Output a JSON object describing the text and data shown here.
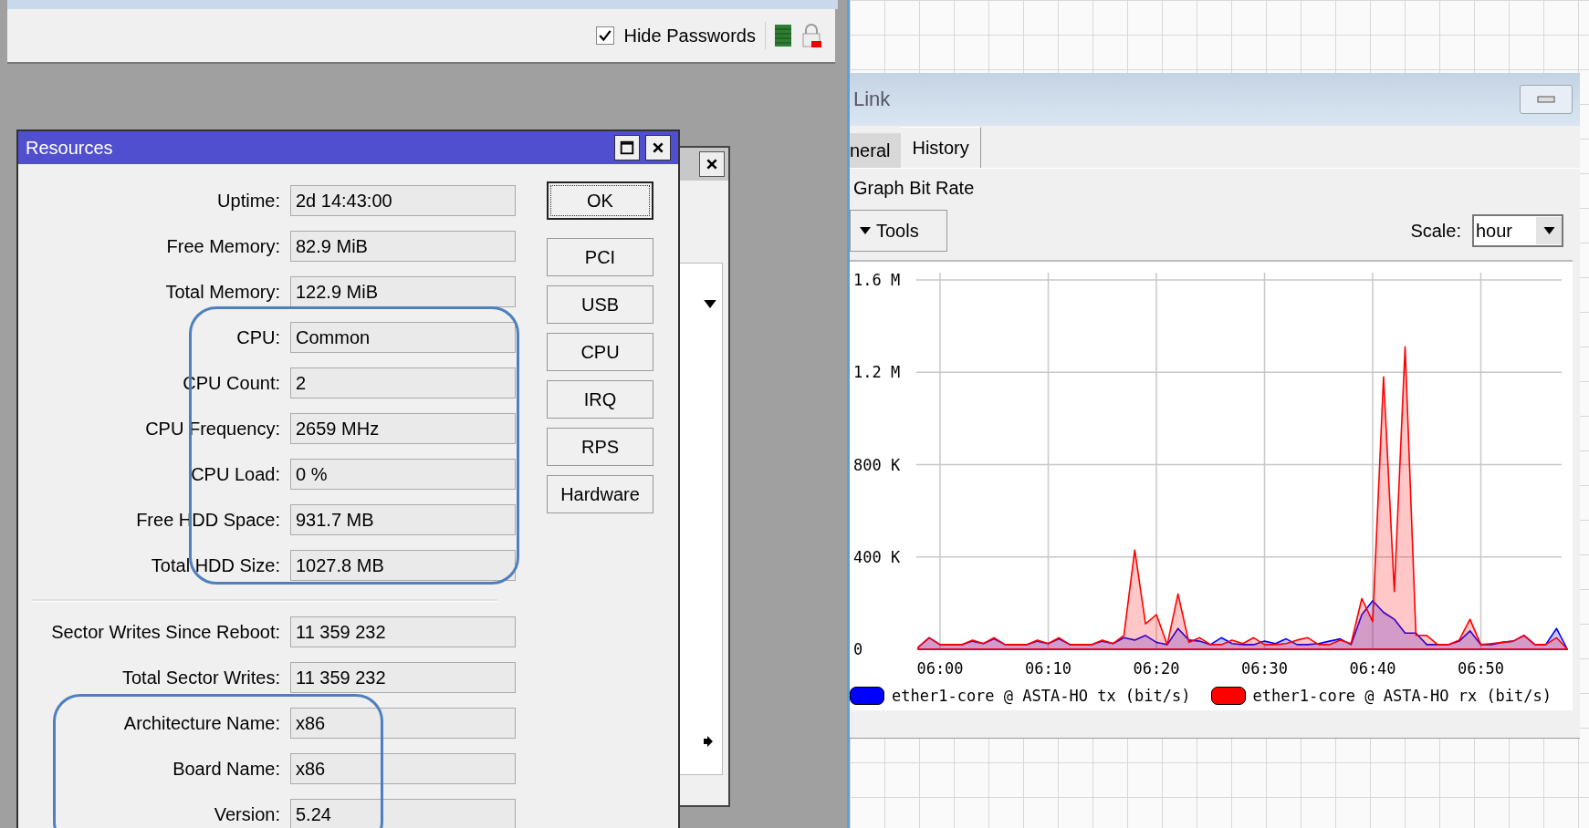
{
  "toolbar": {
    "hide_passwords": {
      "label": "Hide Passwords",
      "checked": true
    }
  },
  "resources": {
    "title": "Resources",
    "sections": [
      {
        "fields": [
          {
            "label": "Uptime:",
            "value": "2d 14:43:00"
          },
          {
            "label": "Free Memory:",
            "value": "82.9 MiB"
          },
          {
            "label": "Total Memory:",
            "value": "122.9 MiB"
          },
          {
            "label": "CPU:",
            "value": "Common"
          },
          {
            "label": "CPU Count:",
            "value": "2"
          },
          {
            "label": "CPU Frequency:",
            "value": "2659 MHz"
          },
          {
            "label": "CPU Load:",
            "value": "0 %"
          },
          {
            "label": "Free HDD Space:",
            "value": "931.7 MB"
          },
          {
            "label": "Total HDD Size:",
            "value": "1027.8 MB"
          }
        ]
      },
      {
        "fields": [
          {
            "label": "Sector Writes Since Reboot:",
            "value": "11 359 232"
          },
          {
            "label": "Total Sector Writes:",
            "value": "11 359 232"
          },
          {
            "label": "Architecture Name:",
            "value": "x86"
          },
          {
            "label": "Board Name:",
            "value": "x86"
          },
          {
            "label": "Version:",
            "value": "5.24"
          }
        ]
      }
    ],
    "buttons": [
      {
        "label": "OK",
        "default": true
      },
      {
        "label": "PCI",
        "default": false
      },
      {
        "label": "USB",
        "default": false
      },
      {
        "label": "CPU",
        "default": false
      },
      {
        "label": "IRQ",
        "default": false
      },
      {
        "label": "RPS",
        "default": false
      },
      {
        "label": "Hardware",
        "default": false
      }
    ]
  },
  "link_window": {
    "title": "Link",
    "tabs": [
      {
        "label": "neral",
        "selected": false
      },
      {
        "label": "History",
        "selected": true
      }
    ],
    "heading": "Graph Bit Rate",
    "tools_button": "Tools",
    "scale": {
      "label": "Scale:",
      "value": "hour"
    },
    "chart_data": {
      "type": "area",
      "categories": [
        null,
        null,
        "06:00",
        null,
        null,
        null,
        null,
        null,
        null,
        null,
        null,
        null,
        "06:10",
        null,
        null,
        null,
        null,
        null,
        null,
        null,
        null,
        null,
        "06:20",
        null,
        null,
        null,
        null,
        null,
        null,
        null,
        null,
        null,
        "06:30",
        null,
        null,
        null,
        null,
        null,
        null,
        null,
        null,
        null,
        "06:40",
        null,
        null,
        null,
        null,
        null,
        null,
        null,
        null,
        null,
        "06:50",
        null,
        null,
        null,
        null,
        null,
        null,
        null,
        null
      ],
      "yticks": [
        {
          "value": 0,
          "label": "0"
        },
        {
          "value": 400000,
          "label": "400 K"
        },
        {
          "value": 800000,
          "label": "800 K"
        },
        {
          "value": 1200000,
          "label": "1.2 M"
        },
        {
          "value": 1600000,
          "label": "1.6 M"
        }
      ],
      "ylim": [
        0,
        1600000
      ],
      "grid": true,
      "series": [
        {
          "name": "ether1-core @ ASTA-HO tx (bit/s)",
          "color": "#0000ff",
          "values": [
            10000,
            50000,
            20000,
            20000,
            20000,
            35000,
            25000,
            45000,
            20000,
            20000,
            20000,
            35000,
            25000,
            45000,
            20000,
            20000,
            20000,
            35000,
            25000,
            50000,
            40000,
            60000,
            30000,
            20000,
            90000,
            40000,
            35000,
            20000,
            50000,
            25000,
            20000,
            20000,
            35000,
            25000,
            45000,
            20000,
            20000,
            25000,
            35000,
            45000,
            20000,
            150000,
            210000,
            160000,
            130000,
            70000,
            70000,
            20000,
            20000,
            20000,
            35000,
            80000,
            20000,
            20000,
            30000,
            35000,
            60000,
            20000,
            20000,
            90000,
            0
          ]
        },
        {
          "name": "ether1-core @ ASTA-HO rx (bit/s)",
          "color": "#ff0000",
          "values": [
            10000,
            50000,
            20000,
            20000,
            20000,
            40000,
            25000,
            50000,
            20000,
            20000,
            20000,
            40000,
            25000,
            50000,
            20000,
            20000,
            20000,
            40000,
            25000,
            60000,
            430000,
            110000,
            150000,
            20000,
            240000,
            30000,
            50000,
            20000,
            20000,
            40000,
            25000,
            50000,
            20000,
            20000,
            25000,
            40000,
            50000,
            20000,
            20000,
            40000,
            25000,
            220000,
            120000,
            1180000,
            250000,
            1310000,
            60000,
            60000,
            20000,
            20000,
            40000,
            130000,
            20000,
            25000,
            30000,
            35000,
            60000,
            20000,
            20000,
            50000,
            0
          ]
        }
      ]
    }
  }
}
